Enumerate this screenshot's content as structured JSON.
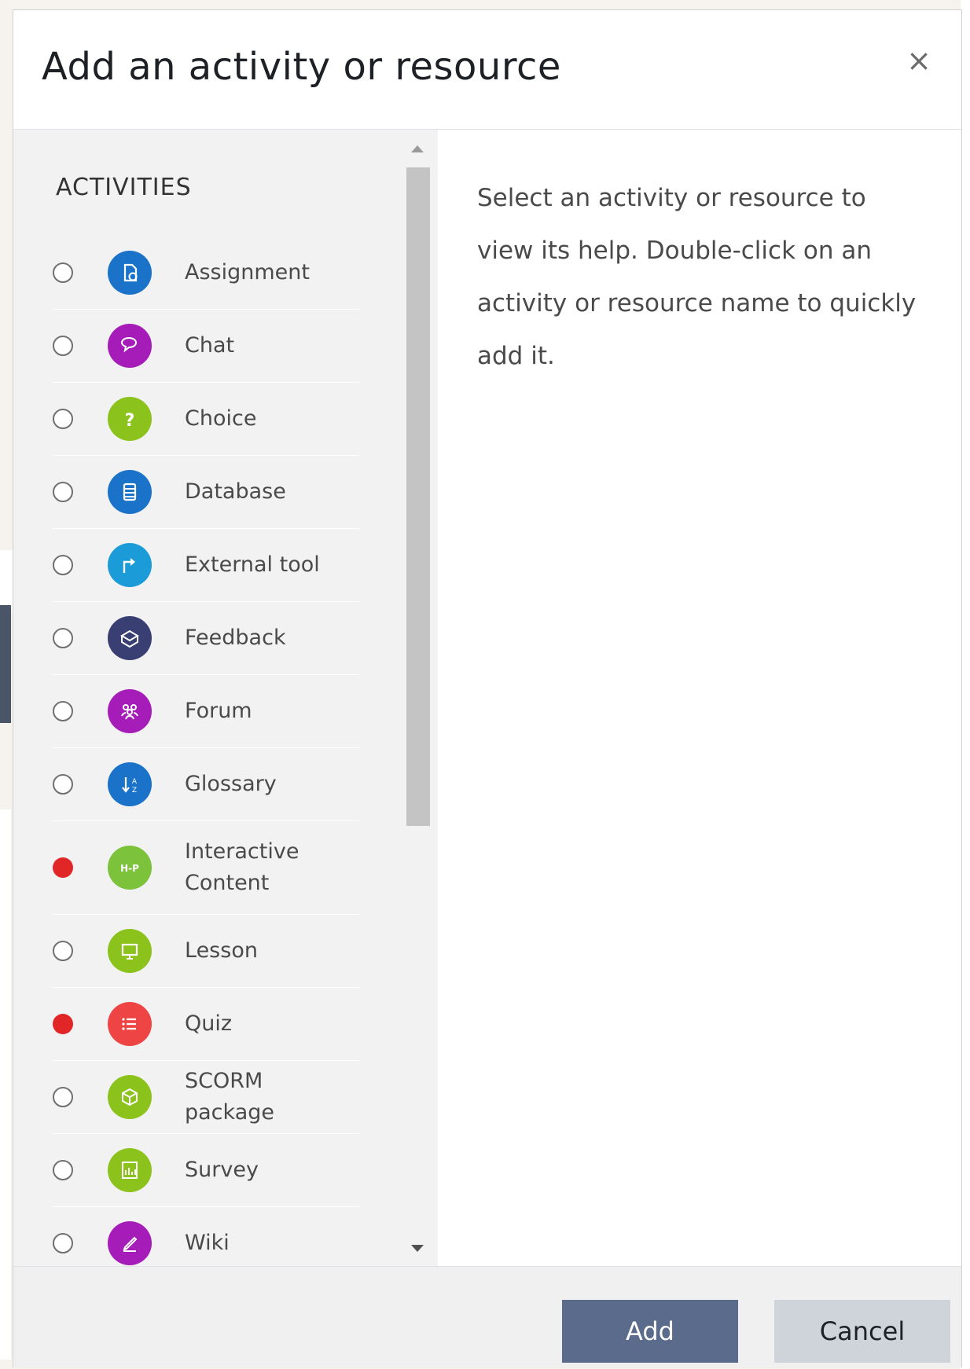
{
  "dialog": {
    "title": "Add an activity or resource",
    "close_symbol": "×"
  },
  "activities": {
    "section_title": "ACTIVITIES",
    "items": [
      {
        "label": "Assignment",
        "icon": "assignment-icon",
        "color": "#1a73c8",
        "checked": false
      },
      {
        "label": "Chat",
        "icon": "chat-icon",
        "color": "#a61cb8",
        "checked": false
      },
      {
        "label": "Choice",
        "icon": "choice-icon",
        "color": "#8cc21c",
        "checked": false
      },
      {
        "label": "Database",
        "icon": "database-icon",
        "color": "#1a73c8",
        "checked": false
      },
      {
        "label": "External tool",
        "icon": "external-tool-icon",
        "color": "#1b9bd7",
        "checked": false
      },
      {
        "label": "Feedback",
        "icon": "feedback-icon",
        "color": "#3a3f73",
        "checked": false
      },
      {
        "label": "Forum",
        "icon": "forum-icon",
        "color": "#a61cb8",
        "checked": false
      },
      {
        "label": "Glossary",
        "icon": "glossary-icon",
        "color": "#1a73c8",
        "checked": false
      },
      {
        "label": "Interactive Content",
        "icon": "h5p-icon",
        "color": "#7cc23a",
        "checked": true
      },
      {
        "label": "Lesson",
        "icon": "lesson-icon",
        "color": "#8cc21c",
        "checked": false
      },
      {
        "label": "Quiz",
        "icon": "quiz-icon",
        "color": "#ef4444",
        "checked": true
      },
      {
        "label": "SCORM package",
        "icon": "scorm-icon",
        "color": "#8cc21c",
        "checked": false
      },
      {
        "label": "Survey",
        "icon": "survey-icon",
        "color": "#8cc21c",
        "checked": false
      },
      {
        "label": "Wiki",
        "icon": "wiki-icon",
        "color": "#a61cb8",
        "checked": false
      }
    ]
  },
  "help": {
    "text": "Select an activity or resource to view its help. Double-click on an activity or resource name to quickly add it."
  },
  "footer": {
    "add_label": "Add",
    "cancel_label": "Cancel"
  }
}
